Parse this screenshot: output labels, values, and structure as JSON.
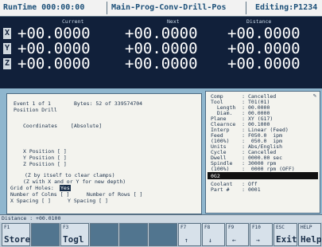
{
  "topbar": {
    "runtime": "RunTime  000:00:00",
    "program": "Main-Prog-Conv-Drill-Pos",
    "editing": "Editing:P1234"
  },
  "dro": {
    "headers": {
      "current": "Current",
      "next": "Next",
      "distance": "Distance"
    },
    "axes": [
      {
        "label": "X",
        "current": "+00.0000",
        "next": "+00.0000",
        "distance": "+00.0000"
      },
      {
        "label": "Y",
        "current": "+00.0000",
        "next": "+00.0000",
        "distance": "+00.0000"
      },
      {
        "label": "Z",
        "current": "+00.0000",
        "next": "+00.0000",
        "distance": "+00.0000"
      }
    ]
  },
  "left_panel": {
    "event": "Event 1 of 1",
    "bytes": "Bytes: 52 of 339574704",
    "title": "Position Drill",
    "coord_label": "Coordinates",
    "coord_value": "[Absolute]",
    "x_pos": "X Position  [          ]",
    "y_pos": "Y Position  [          ]",
    "z_pos": "Z Position  [          ]",
    "hint1": "(Z by itself to clear clamps)",
    "hint2": "(Z with X and or Y for new depth)",
    "grid_label": "Grid of Holes:",
    "grid_value": "Yes",
    "cols": "Number of Colms [  ]",
    "rows": "Number of Rows [  ]",
    "xsp": "X Spacing  [          ]",
    "ysp": "Y Spacing  [          ]"
  },
  "right_panel": {
    "rows": [
      "Comp      : Cancelled",
      "Tool      : T01(01)",
      "  Length  : 00.0000",
      "  Diam.   : 00.0000",
      "Plane     : XY (G17)",
      "Clearnce  : 00.1000",
      "Interp    : Linear (Feed)",
      "Feed      : F050.0  ipm",
      "(100%)    :  050.0  ipm",
      "Units     : Abs/English",
      "Cycle     : Cancelled",
      "Dwell     : 0000.00 sec",
      "Spindle   : 30000 rpm",
      "(100%)    :  0000 rpm (OFF)"
    ],
    "selected": "0G2",
    "rows2": [
      "Coolant   : Off",
      "Part #    : 0001"
    ]
  },
  "distance_bar": "Distance : +00.0100",
  "fkeys": [
    {
      "top": "F1",
      "label": "Store",
      "sym": ""
    },
    {
      "top": "",
      "label": "",
      "sym": ""
    },
    {
      "top": "F3",
      "label": "Togl",
      "sym": ""
    },
    {
      "top": "",
      "label": "",
      "sym": ""
    },
    {
      "top": "",
      "label": "",
      "sym": ""
    },
    {
      "top": "",
      "label": "",
      "sym": ""
    },
    {
      "top": "F7",
      "label": "",
      "sym": "↑"
    },
    {
      "top": "F8",
      "label": "",
      "sym": "↓"
    },
    {
      "top": "F9",
      "label": "",
      "sym": "←"
    },
    {
      "top": "F10",
      "label": "",
      "sym": "→"
    },
    {
      "top": "ESC",
      "label": "Exit",
      "sym": ""
    },
    {
      "top": "HELP",
      "label": "Help",
      "sym": ""
    }
  ]
}
